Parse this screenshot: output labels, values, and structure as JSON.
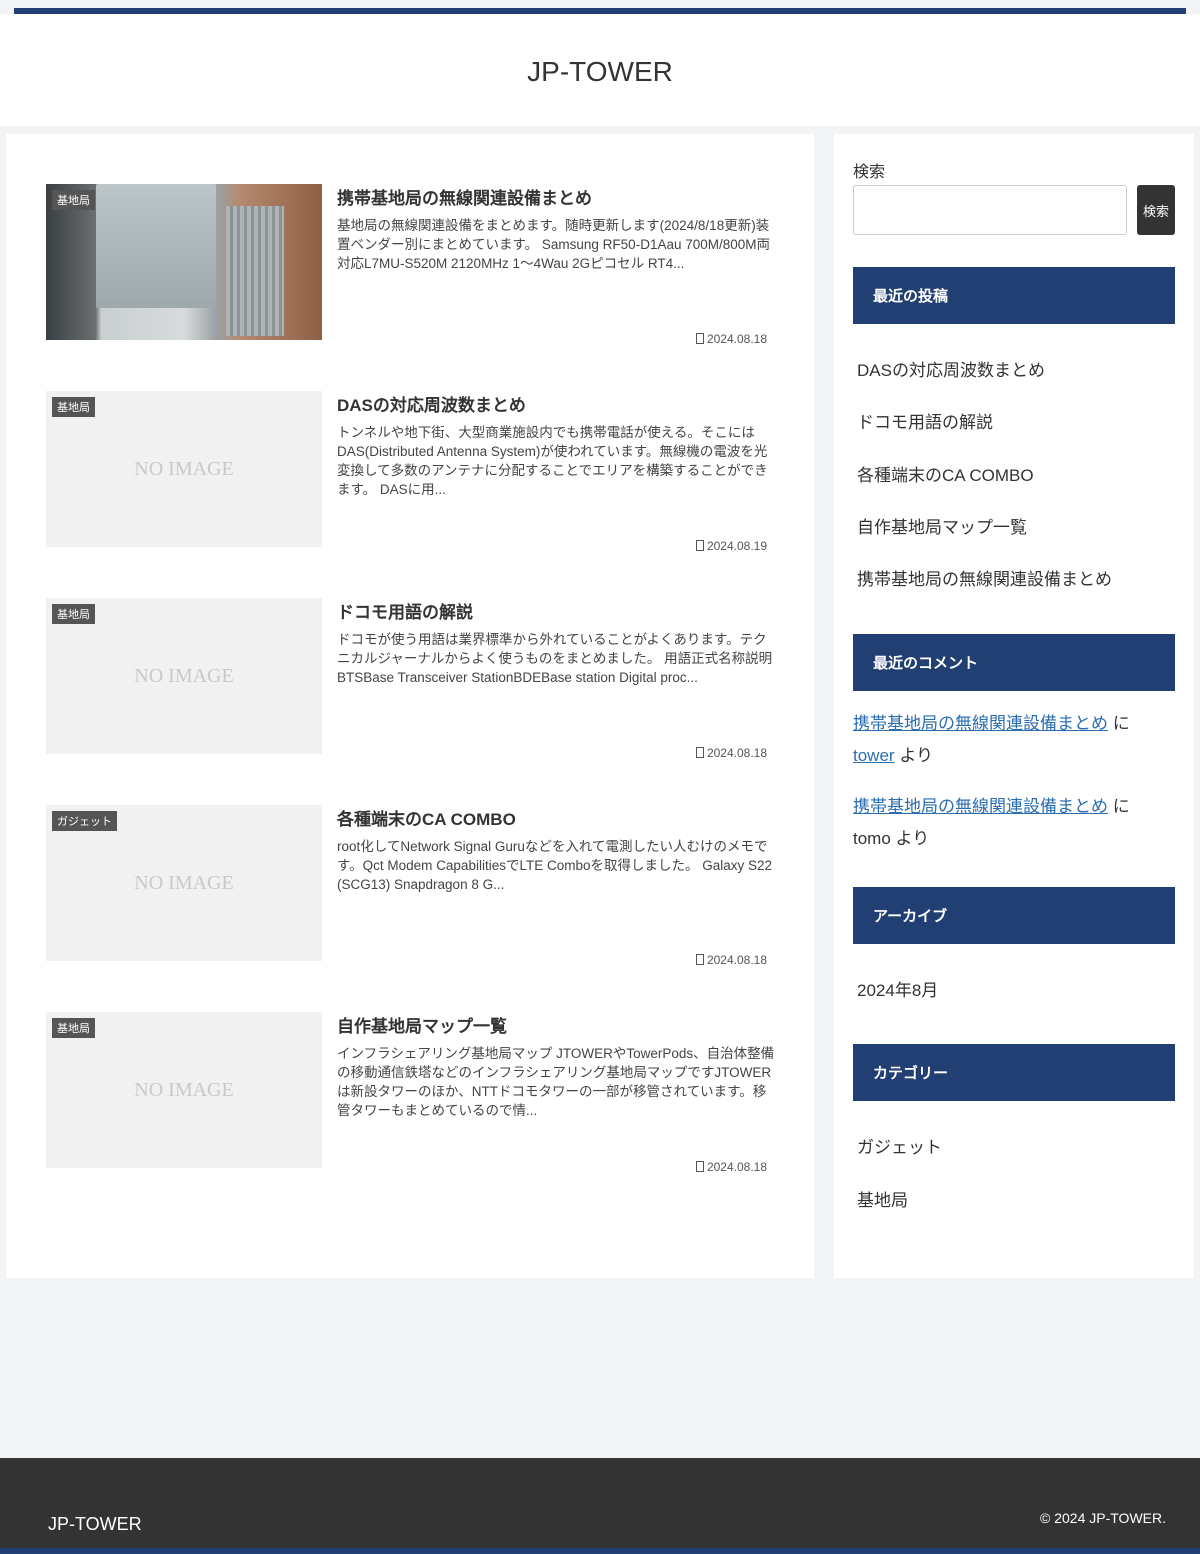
{
  "site": {
    "title": "JP-TOWER"
  },
  "posts": [
    {
      "category": "基地局",
      "title": "携帯基地局の無線関連設備まとめ",
      "excerpt": "基地局の無線関連設備をまとめます。随時更新します(2024/8/18更新)装置ベンダー別にまとめています。 Samsung RF50-D1Aau 700M/800M両対応L7MU-S520M 2120MHz 1〜4Wau 2Gピコセル RT4...",
      "date": "2024.08.18",
      "has_image": true
    },
    {
      "category": "基地局",
      "title": "DASの対応周波数まとめ",
      "excerpt": "トンネルや地下街、大型商業施設内でも携帯電話が使える。そこにはDAS(Distributed Antenna System)が使われています。無線機の電波を光変換して多数のアンテナに分配することでエリアを構築することができます。 DASに用...",
      "date": "2024.08.19",
      "no_image": "NO IMAGE"
    },
    {
      "category": "基地局",
      "title": "ドコモ用語の解説",
      "excerpt": "ドコモが使う用語は業界標準から外れていることがよくあります。テクニカルジャーナルからよく使うものをまとめました。 用語正式名称説明BTSBase Transceiver StationBDEBase station Digital proc...",
      "date": "2024.08.18",
      "no_image": "NO IMAGE"
    },
    {
      "category": "ガジェット",
      "title": "各種端末のCA COMBO",
      "excerpt": "root化してNetwork Signal Guruなどを入れて電測したい人むけのメモです。Qct Modem CapabilitiesでLTE Comboを取得しました。 Galaxy S22 (SCG13) Snapdragon 8 G...",
      "date": "2024.08.18",
      "no_image": "NO IMAGE"
    },
    {
      "category": "基地局",
      "title": "自作基地局マップ一覧",
      "excerpt": "インフラシェアリング基地局マップ JTOWERやTowerPods、自治体整備の移動通信鉄塔などのインフラシェアリング基地局マップですJTOWERは新設タワーのほか、NTTドコモタワーの一部が移管されています。移管タワーもまとめているので情...",
      "date": "2024.08.18",
      "no_image": "NO IMAGE"
    }
  ],
  "sidebar": {
    "search_label": "検索",
    "search_button": "検索",
    "recent_posts_title": "最近の投稿",
    "recent_posts": [
      "DASの対応周波数まとめ",
      "ドコモ用語の解説",
      "各種端末のCA COMBO",
      "自作基地局マップ一覧",
      "携帯基地局の無線関連設備まとめ"
    ],
    "recent_comments_title": "最近のコメント",
    "recent_comments": [
      {
        "post": "携帯基地局の無線関連設備まとめ",
        "on": "に",
        "author": "tower",
        "by": "より",
        "author_is_link": true
      },
      {
        "post": "携帯基地局の無線関連設備まとめ",
        "on": "に",
        "author": "tomo",
        "by": "より",
        "author_is_link": false
      }
    ],
    "archives_title": "アーカイブ",
    "archives": [
      "2024年8月"
    ],
    "categories_title": "カテゴリー",
    "categories": [
      "ガジェット",
      "基地局"
    ]
  },
  "footer": {
    "title": "JP-TOWER",
    "copyright": "© 2024 JP-TOWER."
  }
}
